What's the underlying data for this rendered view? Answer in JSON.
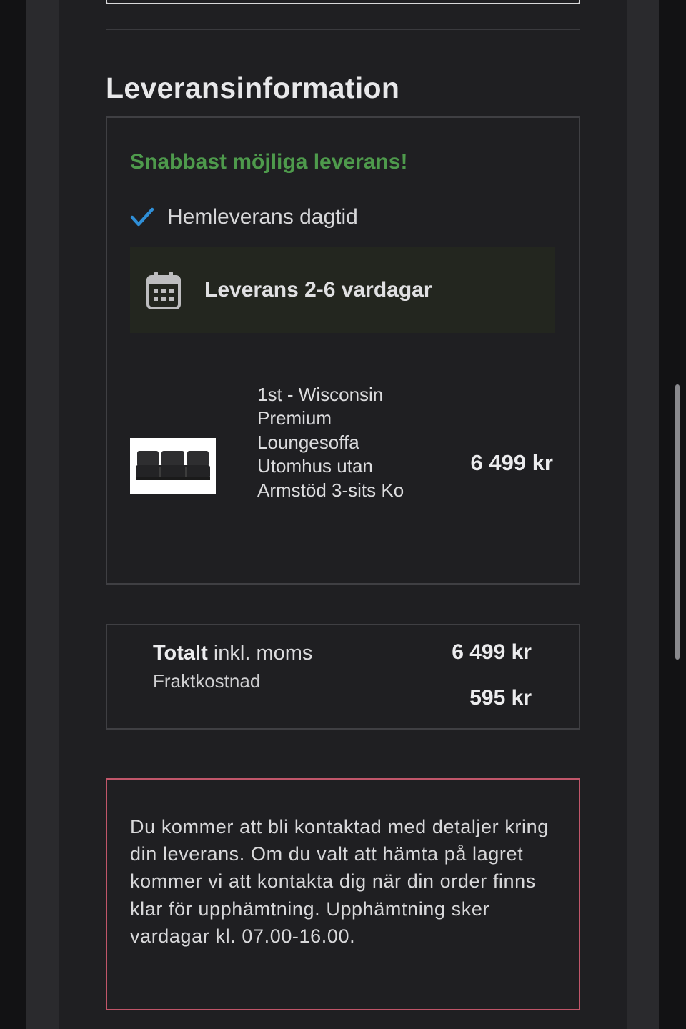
{
  "section": {
    "title": "Leveransinformation"
  },
  "delivery": {
    "promo": "Snabbast möjliga leverans!",
    "method": "Hemleverans dagtid",
    "eta": "Leverans 2-6 vardagar",
    "icons": {
      "check": "check-icon",
      "calendar": "calendar-icon"
    },
    "colors": {
      "promo": "#4e9a4c",
      "check": "#2f8fd8"
    }
  },
  "product": {
    "name": "1st - Wisconsin Premium Loungesoffa Utomhus utan Armstöd 3-sits Ko",
    "price": "6 499 kr"
  },
  "totals": {
    "label_bold": "Totalt",
    "label_rest": " inkl. moms",
    "value": "6 499 kr",
    "freight_label": "Fraktkostnad",
    "freight_value": "595 kr"
  },
  "notice": {
    "text": "Du kommer att bli kontaktad med detaljer kring din leverans. Om du valt att hämta på lagret kommer vi att kontakta dig när din order finns klar för upphämtning. Upphämtning sker vardagar kl. 07.00-16.00.",
    "border_color": "#c1566a"
  }
}
